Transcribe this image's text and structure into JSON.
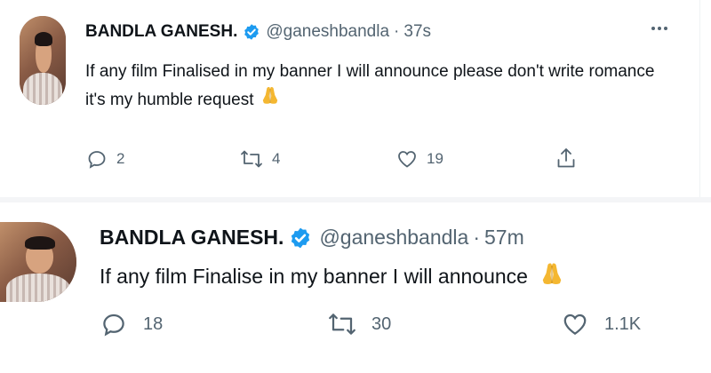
{
  "tweets": [
    {
      "name": "BANDLA GANESH.",
      "handle": "@ganeshbandla",
      "separator": "·",
      "time": "37s",
      "line1": "If any film Finalised in my banner I will announce please don't write romance",
      "line2": "it's my humble request",
      "emoji": "folded-hands",
      "replies": "2",
      "retweets": "4",
      "likes": "19",
      "more_icon": "more-icon"
    },
    {
      "name": "BANDLA GANESH.",
      "handle": "@ganeshbandla",
      "separator": "·",
      "time": "57m",
      "line1": "If any film Finalise in my banner I will announce",
      "emoji": "folded-hands",
      "replies": "18",
      "retweets": "30",
      "likes": "1.1K"
    }
  ],
  "colors": {
    "verified": "#1d9bf0",
    "muted": "#536471",
    "text": "#0f1419",
    "emoji": "#f4b731"
  }
}
